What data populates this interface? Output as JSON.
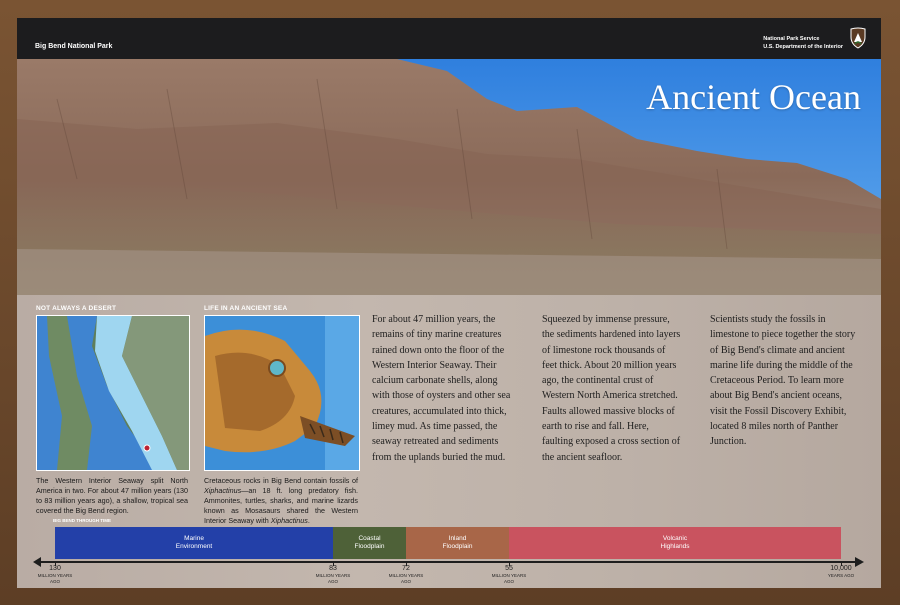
{
  "header": {
    "park_name": "Big Bend National Park",
    "agency_line1": "National Park Service",
    "agency_line2": "U.S. Department of the Interior",
    "title": "Ancient Ocean"
  },
  "left_section": {
    "label": "NOT ALWAYS A DESERT",
    "caption": "The Western Interior Seaway split North America in two. For about 47 million years (130 to 83 million years ago), a shallow, tropical sea covered the Big Bend region."
  },
  "middle_section": {
    "label": "LIFE IN AN ANCIENT SEA",
    "caption_prefix": "Cretaceous rocks in Big Bend contain fossils of ",
    "caption_italic": "Xiphactinus",
    "caption_middle": "—an 18 ft. long predatory fish. Ammonites, turtles, sharks, and marine lizards known as Mosasaurs shared the Western Interior Seaway with ",
    "caption_italic2": "Xiphactinus",
    "caption_end": "."
  },
  "text_columns": [
    "For about 47 million years, the remains of tiny marine creatures rained down onto the floor of the Western Interior Seaway. Their calcium carbonate shells, along with those of oysters and other sea creatures, accumulated into thick, limey mud. As time passed, the seaway retreated and sediments from the uplands buried the mud.",
    "Squeezed by immense pressure, the sediments hardened into layers of limestone rock thousands of feet thick. About 20 million years ago, the continental crust of Western North America stretched. Faults allowed massive blocks of earth to rise and fall. Here, faulting exposed a cross section of the ancient seafloor.",
    "Scientists study the fossils in limestone to piece together the story of Big Bend's climate and ancient marine life during the middle of the Cretaceous Period. To learn more about Big Bend's ancient oceans, visit the Fossil Discovery Exhibit, located 8 miles north of Panther Junction."
  ],
  "timeline": {
    "label": "BIG BEND THROUGH TIME",
    "unit": "MILLION YEARS AGO",
    "last_unit": "YEARS AGO",
    "eras": [
      {
        "name_line1": "Marine",
        "name_line2": "Environment",
        "color": "#2340a8",
        "start": 130,
        "end": 83
      },
      {
        "name_line1": "Coastal",
        "name_line2": "Floodplain",
        "color": "#4e6138",
        "start": 83,
        "end": 72
      },
      {
        "name_line1": "Inland",
        "name_line2": "Floodplain",
        "color": "#a86648",
        "start": 72,
        "end": 55
      },
      {
        "name_line1": "Volcanic",
        "name_line2": "Highlands",
        "color": "#c9535f",
        "start": 55,
        "end": 0.01
      }
    ],
    "ticks": [
      "130",
      "83",
      "72",
      "55",
      "10,000"
    ]
  },
  "colors": {
    "sky": "#3f8fe0",
    "rock": "#8f6e5e",
    "header_bg": "#1c1c1e",
    "panel_bg": "#bcafa7"
  }
}
